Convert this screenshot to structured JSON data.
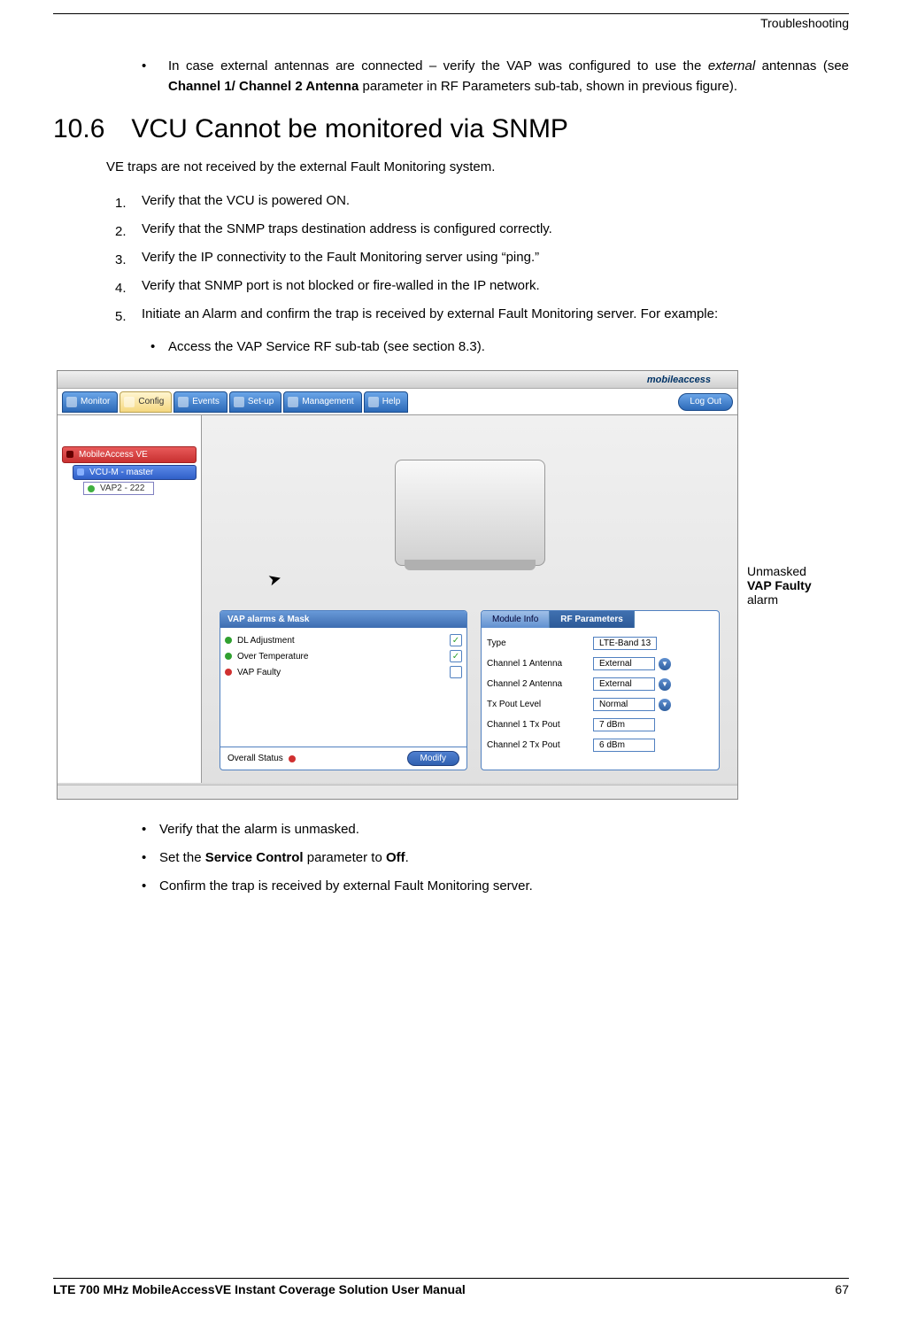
{
  "header": {
    "section": "Troubleshooting"
  },
  "intro_bullet": {
    "pre": "In case external antennas are connected – verify the VAP was configured to use the ",
    "italic": "external",
    "mid": " antennas (see ",
    "bold": "Channel 1/ Channel 2 Antenna",
    "post": " parameter in RF Parameters sub-tab, shown in previous figure)."
  },
  "section": {
    "number": "10.6",
    "title": "VCU Cannot be monitored via SNMP"
  },
  "lead": "VE traps are not received by the external Fault Monitoring system.",
  "steps": [
    "Verify that the VCU is powered ON.",
    "Verify that the SNMP traps destination address is configured correctly.",
    "Verify the IP connectivity to the Fault Monitoring server using “ping.”",
    "Verify that SNMP port is not blocked or fire-walled in the IP network.",
    "Initiate an Alarm and confirm the trap is received by external Fault Monitoring server. For example:"
  ],
  "sub_step": "Access the VAP Service RF sub-tab (see section 8.3).",
  "screenshot": {
    "logo": "mobileaccess",
    "nav": {
      "monitor": "Monitor",
      "config": "Config",
      "events": "Events",
      "setup": "Set-up",
      "management": "Management",
      "help": "Help",
      "logout": "Log Out"
    },
    "tree": {
      "root": "MobileAccess VE",
      "vcu": "VCU-M - master",
      "vap": "VAP2 - 222"
    },
    "alarms": {
      "title": "VAP alarms & Mask",
      "items": [
        {
          "label": "DL Adjustment",
          "status": "green",
          "checked": true
        },
        {
          "label": "Over Temperature",
          "status": "green",
          "checked": true
        },
        {
          "label": "VAP Faulty",
          "status": "red",
          "checked": false
        }
      ],
      "overall": "Overall Status",
      "modify": "Modify"
    },
    "tabs": {
      "module": "Module Info",
      "rf": "RF Parameters"
    },
    "params": {
      "type_label": "Type",
      "type_value": "LTE-Band 13",
      "ch1a_label": "Channel 1 Antenna",
      "ch1a_value": "External",
      "ch2a_label": "Channel 2 Antenna",
      "ch2a_value": "External",
      "txp_label": "Tx Pout Level",
      "txp_value": "Normal",
      "ch1tx_label": "Channel 1 Tx Pout",
      "ch1tx_value": "7 dBm",
      "ch2tx_label": "Channel 2 Tx Pout",
      "ch2tx_value": "6 dBm"
    }
  },
  "annotation": {
    "pre": "Unmasked ",
    "bold": "VAP Faulty",
    "post": " alarm"
  },
  "after_bullets": {
    "b1": "Verify that the alarm is unmasked.",
    "b2_pre": "Set the ",
    "b2_bold1": "Service Control",
    "b2_mid": " parameter to ",
    "b2_bold2": "Off",
    "b2_post": ".",
    "b3": "Confirm the trap is received by external Fault Monitoring server."
  },
  "footer": {
    "title": "LTE 700 MHz MobileAccessVE Instant Coverage Solution User Manual",
    "page": "67"
  }
}
